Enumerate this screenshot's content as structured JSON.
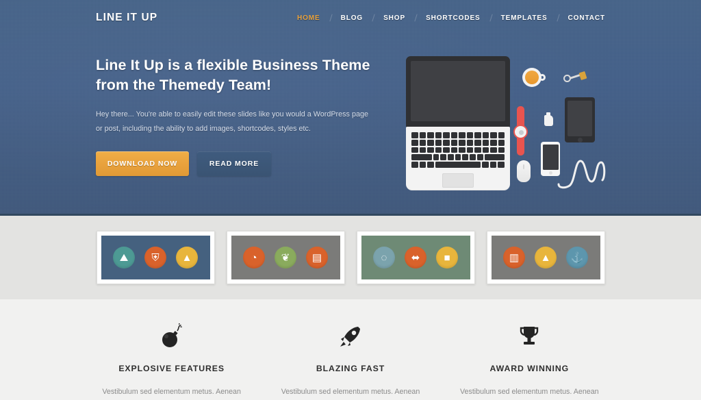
{
  "site": {
    "logo": "LINE IT UP"
  },
  "nav": {
    "items": [
      {
        "label": "HOME",
        "active": true
      },
      {
        "label": "BLOG",
        "active": false
      },
      {
        "label": "SHOP",
        "active": false
      },
      {
        "label": "SHORTCODES",
        "active": false
      },
      {
        "label": "TEMPLATES",
        "active": false
      },
      {
        "label": "CONTACT",
        "active": false
      }
    ]
  },
  "hero": {
    "title": "Line It Up is a flexible Business Theme from the Themedy Team!",
    "text": "Hey there... You're able to easily edit these slides like you would a WordPress page or post, including the ability to add images, shortcodes, styles etc.",
    "primary_button": "DOWNLOAD NOW",
    "secondary_button": "READ MORE",
    "background_color": "#456184",
    "accent_color": "#e8a13c",
    "illustration": "flat-desk-workspace-illustration"
  },
  "portfolio": {
    "background_color": "#e3e3e1",
    "thumbnails": [
      {
        "name": "portfolio-thumb-1",
        "background": "#45617f",
        "badges": [
          {
            "icon": "mountain-icon",
            "glyph": "⛰",
            "color": "#4d9a94"
          },
          {
            "icon": "shield-icon",
            "glyph": "⛨",
            "color": "#d9622b"
          },
          {
            "icon": "campfire-icon",
            "glyph": "▲",
            "color": "#e8b53c"
          }
        ]
      },
      {
        "name": "portfolio-thumb-2",
        "background": "#7b7b79",
        "badges": [
          {
            "icon": "compass-icon",
            "glyph": "◔",
            "color": "#d9622b"
          },
          {
            "icon": "leaf-icon",
            "glyph": "❦",
            "color": "#8aab5d"
          },
          {
            "icon": "book-icon",
            "glyph": "▤",
            "color": "#d9622b"
          }
        ]
      },
      {
        "name": "portfolio-thumb-3",
        "background": "#6e8a75",
        "badges": [
          {
            "icon": "bicycle-icon",
            "glyph": "◌",
            "color": "#7ba3ad"
          },
          {
            "icon": "dumbbell-icon",
            "glyph": "⬌",
            "color": "#d9622b"
          },
          {
            "icon": "shirt-icon",
            "glyph": "■",
            "color": "#e8b53c"
          }
        ]
      },
      {
        "name": "portfolio-thumb-4",
        "background": "#7b7b79",
        "badges": [
          {
            "icon": "clipboard-icon",
            "glyph": "▥",
            "color": "#d9622b"
          },
          {
            "icon": "trees-icon",
            "glyph": "▲",
            "color": "#e8b53c"
          },
          {
            "icon": "anchor-icon",
            "glyph": "⚓",
            "color": "#5d96ad"
          }
        ]
      }
    ]
  },
  "features": {
    "background_color": "#f1f1f0",
    "items": [
      {
        "icon": "bomb-icon",
        "title": "EXPLOSIVE FEATURES",
        "text": "Vestibulum sed elementum metus. Aenean"
      },
      {
        "icon": "rocket-icon",
        "title": "BLAZING FAST",
        "text": "Vestibulum sed elementum metus. Aenean"
      },
      {
        "icon": "trophy-icon",
        "title": "AWARD WINNING",
        "text": "Vestibulum sed elementum metus. Aenean"
      }
    ]
  }
}
